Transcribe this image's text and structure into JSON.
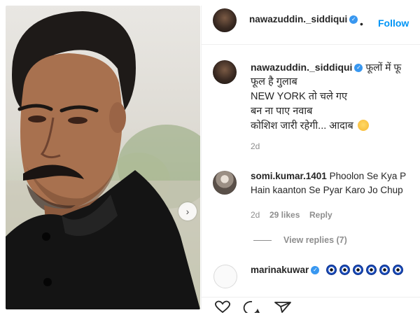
{
  "post": {
    "author": {
      "username": "nawazuddin._siddiqui",
      "verified": true,
      "follow_label": "Follow",
      "separator": "•"
    },
    "photo": {
      "next_button": "›"
    },
    "caption": {
      "username": "nawazuddin._siddiqui",
      "first_line_tail": "फूलों में फू",
      "lines": "फूल है गुलाब\nNEW YORK तो चले गए\nबन ना पाए नवाब\nकोशिश जारी रहेगी... आदाब",
      "emoji": "smiling-face",
      "age": "2d"
    },
    "comments": [
      {
        "username": "somi.kumar.1401",
        "text_line1": "Phoolon Se Kya P",
        "text_line2": "Hain kaanton Se Pyar Karo Jo Chup",
        "age": "2d",
        "likes": "29 likes",
        "reply_label": "Reply",
        "view_replies": "View replies (7)"
      },
      {
        "username": "marinakuwar",
        "verified": true,
        "emoji_count": 6,
        "emoji": "nazar-amulet"
      }
    ],
    "actions": [
      "heart-icon",
      "comment-icon",
      "share-icon"
    ],
    "colors": {
      "link_blue": "#0095f6",
      "verified_blue": "#3897f0",
      "muted_gray": "#8e8e8e",
      "text_dark": "#262626"
    }
  }
}
